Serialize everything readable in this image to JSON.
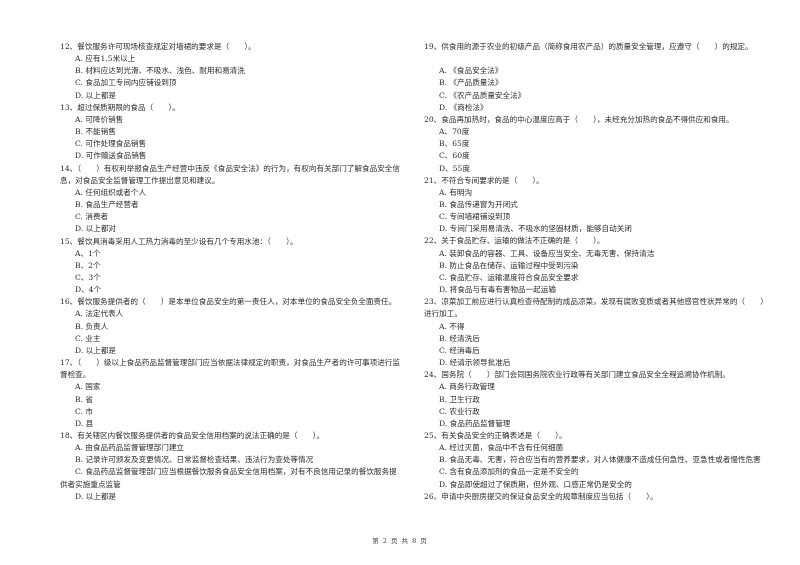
{
  "document": {
    "left_column": [
      {
        "number": "12",
        "stem": "12、餐饮服务许可现场核查规定对墙裙的要求是（　　）。",
        "options": [
          "A. 应有1.5米以上",
          "B. 材料应达到光滑、不吸水、浅色、耐用和易清洗",
          "C. 食品加工专间内应铺设到顶",
          "D. 以上都是"
        ]
      },
      {
        "number": "13",
        "stem": "13、超过保质期限的食品（　　）。",
        "options": [
          "A. 可降价销售",
          "B. 不能销售",
          "C. 可作处理食品销售",
          "D. 可作赠送食品销售"
        ]
      },
      {
        "number": "14",
        "stem": "14、（　　）有权利举报食品生产经营中违反《食品安全法》的行为，有权向有关部门了解食品安全信息，对食品安全监督管理工作提出意见和建议。",
        "options": [
          "A. 任何组织或者个人",
          "B. 食品生产经营者",
          "C. 消费者",
          "D. 以上都对"
        ]
      },
      {
        "number": "15",
        "stem": "15、餐饮具消毒采用人工热力消毒的至少设有几个专用水池：（　　）。",
        "options": [
          "A、1个",
          "B、2个",
          "C、3个",
          "D、4个"
        ]
      },
      {
        "number": "16",
        "stem": "16、餐饮服务提供者的（　　）是本单位食品安全的第一责任人，对本单位的食品安全负全面责任。",
        "options": [
          "A. 法定代表人",
          "B. 负责人",
          "C. 业主",
          "D. 以上都是"
        ]
      },
      {
        "number": "17",
        "stem": "17、（　　）级以上食品药品监督管理部门应当依据法律规定的职责，对食品生产者的许可事项进行监督检查。",
        "options": [
          "A. 国家",
          "B. 省",
          "C. 市",
          "D. 县"
        ]
      },
      {
        "number": "18",
        "stem": "18、有关辖区内餐饮服务提供者的食品安全信用档案的说法正确的是（　　）。",
        "options": [
          "A. 由食品药品监督管理部门建立",
          "B. 记录许可颁发及变更情况、日常监督检查结果、违法行为查处等情况",
          "C. 食品药品监督管理部门应当根据餐饮服务食品安全信用档案，对有不良信用记录的餐饮服务提供者实施重点监管",
          "D. 以上都是"
        ]
      }
    ],
    "right_column": [
      {
        "number": "19",
        "stem": "19、供食用的源于农业的初级产品（简称食用农产品）的质量安全管理，应遵守（　　）的规定。",
        "options": [
          "A. 《食品安全法》",
          "B. 《产品质量法》",
          "C. 《农产品质量安全法》",
          "D. 《商检法》"
        ]
      },
      {
        "number": "20",
        "stem": "20、食品再加热时，食品的中心温度应高于（　　），未经充分加热的食品不得供应和食用。",
        "options": [
          "A、70度",
          "B、65度",
          "C、60度",
          "D、55度"
        ]
      },
      {
        "number": "21",
        "stem": "21、不符合专间要求的是（　　）。",
        "options": [
          "A. 有明沟",
          "B. 食品传递窗为开闭式",
          "C. 专间墙裙铺设到顶",
          "D. 专间门采用易清洗、不吸水的坚固材质，能够自动关闭"
        ]
      },
      {
        "number": "22",
        "stem": "22、关于食品贮存、运输的做法不正确的是（　　）。",
        "options": [
          "A. 装卸食品的容器、工具、设备应当安全、无毒无害、保持清洁",
          "B. 防止食品在储存、运输过程中受到污染",
          "C. 食品贮存、运输温度符合食品安全要求",
          "D. 将食品与有毒有害物品一起运输"
        ]
      },
      {
        "number": "23",
        "stem": "23、凉菜加工前应进行认真检查待配制的成品凉菜，发现有腐败变质或者其他感官性状异常的（　　）进行加工。",
        "options": [
          "A. 不得",
          "B. 经清洗后",
          "C. 经消毒后",
          "D. 经请示领导批准后"
        ]
      },
      {
        "number": "24",
        "stem": "24、国务院（　　）部门会同国务院农业行政等有关部门建立食品安全全程追溯协作机制。",
        "options": [
          "A. 商务行政管理",
          "B. 卫生行政",
          "C. 农业行政",
          "D. 食品药品监督管理"
        ]
      },
      {
        "number": "25",
        "stem": "25、有关食品安全的正确表述是（　　）。",
        "options": [
          "A. 经过灭菌，食品中不含有任何细菌",
          "B. 食品无毒、无害，符合应当有的营养要求，对人体健康不造成任何急性、亚急性或者慢性危害",
          "C. 含有食品添加剂的食品一定是不安全的",
          "D. 食品即使超过了保质期，但外观、口感正常仍是安全的"
        ]
      },
      {
        "number": "26",
        "stem": "26、申请中央厨房提交的保证食品安全的规章制度应当包括（　　）。",
        "options": []
      }
    ],
    "footer": "第 2 页 共 8 页"
  }
}
